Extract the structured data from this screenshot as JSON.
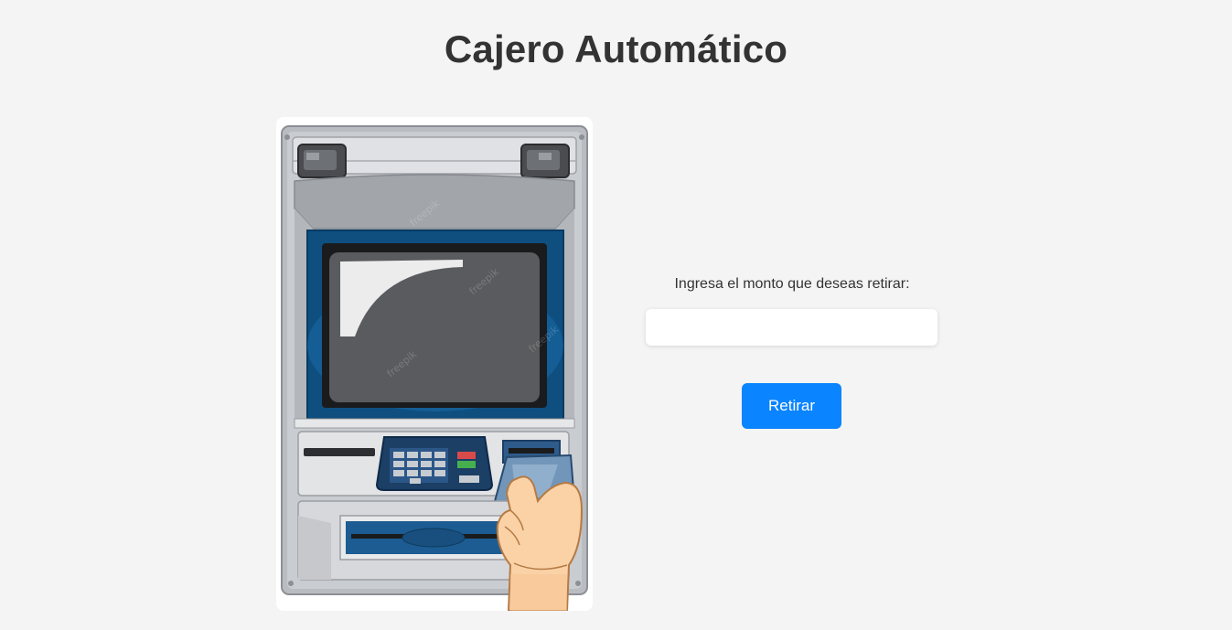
{
  "page": {
    "title": "Cajero Automático"
  },
  "form": {
    "label": "Ingresa el monto que deseas retirar:",
    "amount_value": "",
    "amount_placeholder": "",
    "submit_label": "Retirar"
  },
  "colors": {
    "background": "#f4f4f4",
    "accent": "#0a84ff",
    "text": "#333333"
  },
  "illustration": {
    "icon": "atm-machine-illustration",
    "watermark": "freepik"
  }
}
